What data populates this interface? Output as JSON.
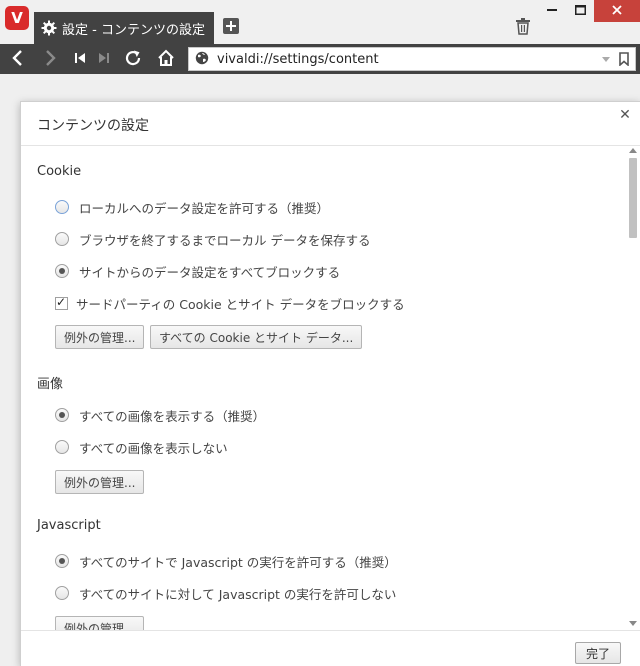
{
  "browser": {
    "logo": "V",
    "tab_title": "設定 - コンテンツの設定",
    "address": "vivaldi://settings/content"
  },
  "dialog": {
    "title": "コンテンツの設定",
    "done_label": "完了",
    "sections": {
      "cookie": {
        "heading": "Cookie",
        "options": [
          "ローカルへのデータ設定を許可する（推奨）",
          "ブラウザを終了するまでローカル データを保存する",
          "サイトからのデータ設定をすべてブロックする"
        ],
        "selected_index": 2,
        "checkbox_label": "サードパーティの Cookie とサイト データをブロックする",
        "checkbox_checked": true,
        "exceptions_button": "例外の管理...",
        "all_cookies_button": "すべての Cookie とサイト データ..."
      },
      "images": {
        "heading": "画像",
        "options": [
          "すべての画像を表示する（推奨）",
          "すべての画像を表示しない"
        ],
        "selected_index": 0,
        "exceptions_button": "例外の管理..."
      },
      "javascript": {
        "heading": "Javascript",
        "options": [
          "すべてのサイトで Javascript の実行を許可する（推奨）",
          "すべてのサイトに対して Javascript の実行を許可しない"
        ],
        "selected_index": 0,
        "exceptions_button": "例外の管理..."
      }
    }
  },
  "colors": {
    "chrome_dark": "#424242",
    "close_red": "#c7423b",
    "vivaldi_red": "#d92b2b"
  }
}
